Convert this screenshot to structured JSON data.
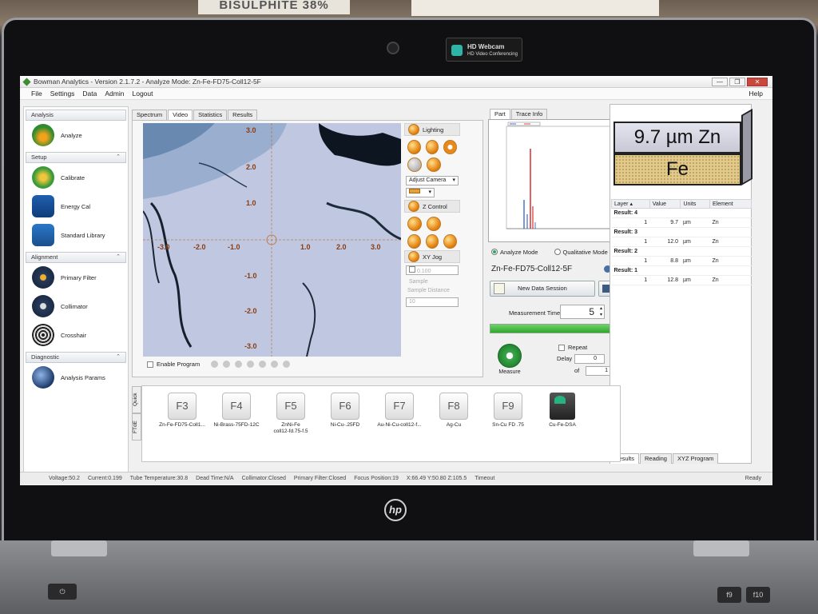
{
  "environment": {
    "background_label": "BISULPHITE 38%",
    "webcam_badge_title": "HD Webcam",
    "webcam_badge_sub": "HD Video Conferencing",
    "laptop_logo": "hp"
  },
  "window": {
    "title": "Bowman Analytics - Version 2.1.7.2 - Analyze Mode: Zn-Fe-FD75-Coll12-5F",
    "controls": [
      "—",
      "❐",
      "✕"
    ]
  },
  "menu": {
    "items": [
      "File",
      "Settings",
      "Data",
      "Admin",
      "Logout"
    ],
    "help": "Help"
  },
  "sidebar": {
    "sections": [
      {
        "label": "Analysis",
        "items": [
          {
            "label": "Analyze",
            "icon": "analyze-icon"
          }
        ]
      },
      {
        "label": "Setup",
        "items": [
          {
            "label": "Calibrate",
            "icon": "calibrate-icon"
          },
          {
            "label": "Energy Cal",
            "icon": "energy-cal-icon"
          },
          {
            "label": "Standard Library",
            "icon": "standard-library-icon"
          }
        ]
      },
      {
        "label": "Alignment",
        "items": [
          {
            "label": "Primary Filter",
            "icon": "primary-filter-icon"
          },
          {
            "label": "Collimator",
            "icon": "collimator-icon"
          },
          {
            "label": "Crosshair",
            "icon": "crosshair-icon"
          }
        ]
      },
      {
        "label": "Diagnostic",
        "items": [
          {
            "label": "Analysis Params",
            "icon": "analysis-params-icon"
          }
        ]
      }
    ]
  },
  "main_tabs": [
    "Spectrum",
    "Video",
    "Statistics",
    "Results"
  ],
  "main_tabs_active": "Video",
  "video": {
    "x_labels": [
      "-3.0",
      "-2.0",
      "-1.0",
      "1.0",
      "2.0",
      "3.0"
    ],
    "y_labels": [
      "3.0",
      "2.0",
      "1.0",
      "-1.0",
      "-2.0",
      "-3.0"
    ]
  },
  "video_controls": {
    "lighting": "Lighting",
    "adjust_camera": "Adjust Camera",
    "z_control": "Z Control",
    "xy_jog": "XY Jog",
    "jog_value": "0.100",
    "sample_label": "Sample",
    "sample_distance_label": "Sample Distance",
    "sample_distance_value": "10"
  },
  "enable_program": "Enable Program",
  "spectrum_tabs": [
    "Part",
    "Trace Info"
  ],
  "mode": {
    "analyze": "Analyze Mode",
    "qualitative": "Qualitative Mode",
    "selected": "analyze"
  },
  "sample_name": "Zn-Fe-FD75-Coll12-5F",
  "new_session": "New Data Session",
  "measurement": {
    "label": "Measurement Time",
    "value": "5",
    "progress": 1.0
  },
  "measure_label": "Measure",
  "repeat_label": "Repeat",
  "delay_label": "Delay",
  "delay_value": "0",
  "of_label": "of",
  "of_value": "1",
  "layers": {
    "top": "9.7 µm Zn",
    "bottom": "Fe"
  },
  "results": {
    "headers": [
      "Layer",
      "Value",
      "Units",
      "Element"
    ],
    "groups": [
      {
        "label": "Result: 4",
        "rows": [
          {
            "layer": "1",
            "value": "9.7",
            "units": "µm",
            "element": "Zn"
          }
        ]
      },
      {
        "label": "Result: 3",
        "rows": [
          {
            "layer": "1",
            "value": "12.0",
            "units": "µm",
            "element": "Zn"
          }
        ]
      },
      {
        "label": "Result: 2",
        "rows": [
          {
            "layer": "1",
            "value": "8.8",
            "units": "µm",
            "element": "Zn"
          }
        ]
      },
      {
        "label": "Result: 1",
        "rows": [
          {
            "layer": "1",
            "value": "12.8",
            "units": "µm",
            "element": "Zn"
          }
        ]
      }
    ]
  },
  "right_tabs": [
    "Results",
    "Reading",
    "XYZ Program"
  ],
  "quick_tabs": [
    "Quick",
    "FTdE"
  ],
  "quick_keys": [
    {
      "key": "F3",
      "label": "Zn-Fe-FD75-Coll1..."
    },
    {
      "key": "F4",
      "label": "Ni-Brass-75FD-12C"
    },
    {
      "key": "F5",
      "label": "ZnNi-Fe",
      "label2": "coll12-fd.75-f.5"
    },
    {
      "key": "F6",
      "label": "Ni-Cu-.25FD"
    },
    {
      "key": "F7",
      "label": "Au-Ni-Cu-coll12-f..."
    },
    {
      "key": "F8",
      "label": "Ag-Cu"
    },
    {
      "key": "F9",
      "label": "Sn-Cu FD .75"
    },
    {
      "key": "",
      "label": "Cu-Fe-DSA"
    }
  ],
  "status": {
    "voltage": "Voltage:50.2",
    "current": "Current:0.199",
    "tube_temp": "Tube Temperature:30.8",
    "dead_time": "Dead Time:N/A",
    "collimator": "Collimator:Closed",
    "primary_filter": "Primary Filter:Closed",
    "focus": "Focus Position:19",
    "coords": "X:66.49 Y:50.80 Z:105.5",
    "timeout": "Timeout",
    "ready": "Ready"
  },
  "keyboard": {
    "fkeys": [
      "f9",
      "f10"
    ]
  },
  "colors": {
    "accent_green": "#2fa82c",
    "layer_top": "#c8c8d6",
    "layer_bottom": "#e0c98a"
  }
}
